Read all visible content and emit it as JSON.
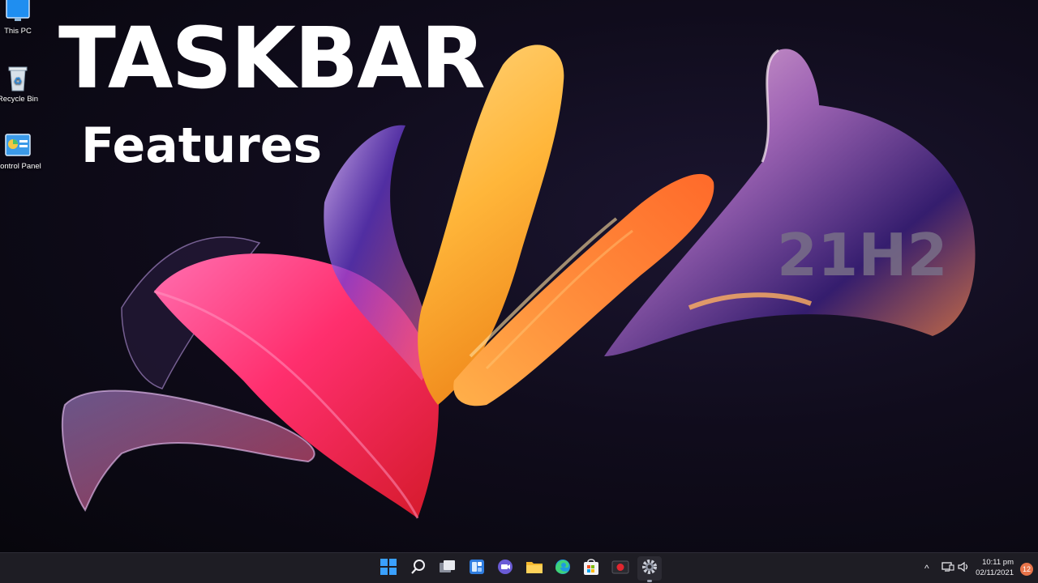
{
  "desktop": {
    "icons": [
      {
        "label": "This PC",
        "icon": "monitor-icon"
      },
      {
        "label": "Recycle Bin",
        "icon": "recycle-bin-icon"
      },
      {
        "label": "Control Panel",
        "icon": "control-panel-icon"
      }
    ],
    "overlay": {
      "title": "TASKBAR",
      "subtitle": "Features",
      "version": "21H2"
    }
  },
  "taskbar": {
    "apps": [
      {
        "name": "Start",
        "icon": "windows-start-icon"
      },
      {
        "name": "Search",
        "icon": "search-icon"
      },
      {
        "name": "Task View",
        "icon": "task-view-icon"
      },
      {
        "name": "Widgets",
        "icon": "widgets-icon"
      },
      {
        "name": "Chat",
        "icon": "chat-icon"
      },
      {
        "name": "File Explorer",
        "icon": "folder-icon"
      },
      {
        "name": "Edge",
        "icon": "edge-icon"
      },
      {
        "name": "Store",
        "icon": "store-icon"
      },
      {
        "name": "Recorder",
        "icon": "record-icon"
      },
      {
        "name": "Settings",
        "icon": "gear-icon"
      }
    ],
    "tray": {
      "chevron": "^",
      "time": "10:11 pm",
      "date": "02/11/2021",
      "notification_count": "12"
    }
  },
  "colors": {
    "taskbar_bg": "#1e1d24",
    "accent_blue": "#3aa0ff",
    "notification": "#e8744a"
  }
}
